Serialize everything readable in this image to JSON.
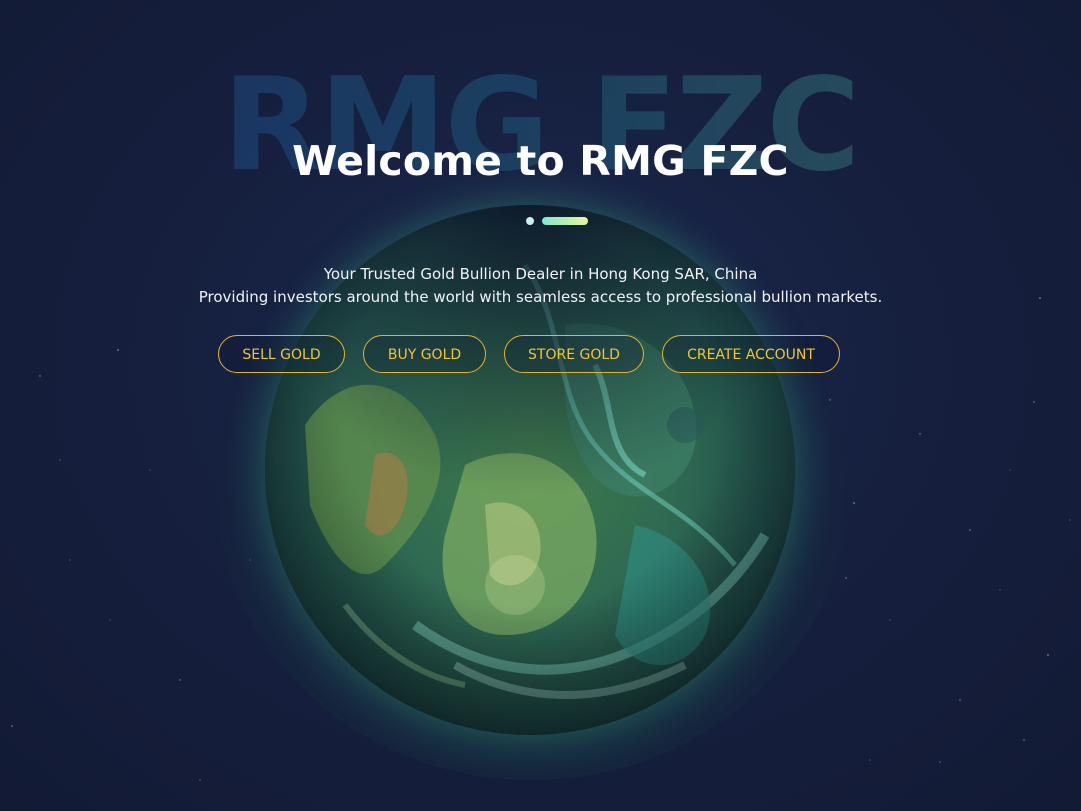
{
  "hero": {
    "background_word": "RMG FZC",
    "title": "Welcome to RMG FZC",
    "subtitle_line1": "Your Trusted Gold Bullion Dealer in Hong Kong SAR, China",
    "subtitle_line2": "Providing investors around the world with seamless access to professional bullion markets."
  },
  "actions": {
    "sell_label": "SELL GOLD",
    "buy_label": "BUY GOLD",
    "store_label": "STORE GOLD",
    "create_label": "CREATE ACCOUNT"
  },
  "colors": {
    "background": "#16203f",
    "accent_gold": "#f2c531",
    "divider_start": "#7fe6d0",
    "divider_end": "#e8f79a"
  }
}
